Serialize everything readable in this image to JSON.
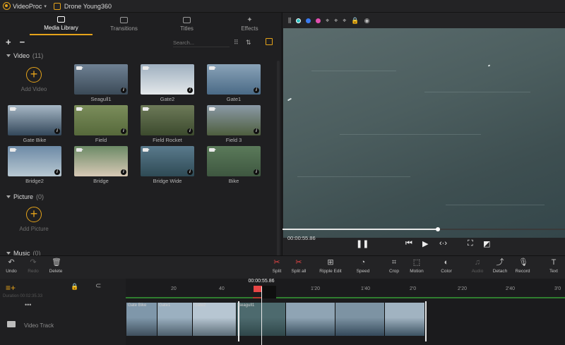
{
  "app": {
    "name": "VideoProc",
    "project": "Drone Young360"
  },
  "tabs": [
    {
      "label": "Media Library",
      "active": true
    },
    {
      "label": "Transitions",
      "active": false
    },
    {
      "label": "Titles",
      "active": false
    },
    {
      "label": "Effects",
      "active": false
    }
  ],
  "library": {
    "search_placeholder": "Search...",
    "video_section": {
      "title": "Video",
      "count": "(11)",
      "add_label": "Add Video"
    },
    "clips": [
      {
        "name": "Seagull1",
        "c1": "#6f8194",
        "c2": "#3b4a57"
      },
      {
        "name": "Gate2",
        "c1": "#9fb0bf",
        "c2": "#e4e8ea"
      },
      {
        "name": "Gate1",
        "c1": "#8aa3b8",
        "c2": "#4a6a86"
      },
      {
        "name": "Gate Bike",
        "c1": "#a7b8c6",
        "c2": "#33475a"
      },
      {
        "name": "Field",
        "c1": "#7b8d5b",
        "c2": "#56693b"
      },
      {
        "name": "Field Rocket",
        "c1": "#6d7a58",
        "c2": "#3c4a2e"
      },
      {
        "name": "Field 3",
        "c1": "#8b9aa7",
        "c2": "#4e5e3e"
      },
      {
        "name": "Bridge2",
        "c1": "#6d8aa6",
        "c2": "#b8c8d2"
      },
      {
        "name": "Bridge",
        "c1": "#6c8a66",
        "c2": "#d8c9b6"
      },
      {
        "name": "Bridge Wide",
        "c1": "#5a7a8c",
        "c2": "#2f4a55"
      },
      {
        "name": "Bike",
        "c1": "#5b7a5a",
        "c2": "#3e5740"
      }
    ],
    "picture_section": {
      "title": "Picture",
      "count": "(0)",
      "add_label": "Add Picture"
    },
    "music_section": {
      "title": "Music",
      "count": "(0)"
    }
  },
  "preview": {
    "time": "00:00:55.86",
    "progress": 0.55
  },
  "tools": [
    {
      "label": "Undo",
      "icon": "↶",
      "dim": false,
      "red": false
    },
    {
      "label": "Redo",
      "icon": "↷",
      "dim": true,
      "red": false
    },
    {
      "label": "Delete",
      "icon": "🗑",
      "dim": false,
      "red": false
    },
    {
      "label": "Split",
      "icon": "✂",
      "dim": false,
      "red": true
    },
    {
      "label": "Split all",
      "icon": "✂",
      "dim": false,
      "red": true
    },
    {
      "label": "Ripple Edit",
      "icon": "⊞",
      "dim": false,
      "red": false
    },
    {
      "label": "Speed",
      "icon": "◔",
      "dim": false,
      "red": false
    },
    {
      "label": "Crop",
      "icon": "⌗",
      "dim": false,
      "red": false
    },
    {
      "label": "Motion",
      "icon": "⬚",
      "dim": false,
      "red": false
    },
    {
      "label": "Color",
      "icon": "◐",
      "dim": false,
      "red": false
    },
    {
      "label": "Audio",
      "icon": "♫",
      "dim": true,
      "red": false
    },
    {
      "label": "Detach",
      "icon": "⤴",
      "dim": false,
      "red": false
    },
    {
      "label": "Record",
      "icon": "🎙",
      "dim": false,
      "red": false
    },
    {
      "label": "Text",
      "icon": "T",
      "dim": false,
      "red": false
    }
  ],
  "timeline": {
    "playhead_time": "00:00:55.86",
    "ticks": [
      "20",
      "40",
      "1'20",
      "1'40",
      "2'0",
      "2'20",
      "2'40",
      "3'0"
    ],
    "duration_label": "Duration   00:02:35.33",
    "track_label": "Video Track",
    "segments": [
      {
        "name": "Gate Bike",
        "color": "#7f97aa",
        "dark": "#3f4f5c"
      },
      {
        "name": "Gate1",
        "color": "#9bb0c0",
        "dark": "#4d5f6c"
      },
      {
        "name": "Gate2",
        "color": "#b7c6d2",
        "dark": "#5c6d78"
      },
      {
        "name": "Seagull1",
        "color": "#4d6a6e",
        "dark": "#2f474a"
      },
      {
        "name": "",
        "color": "#8fa4b4",
        "dark": "#3a4f5e"
      },
      {
        "name": "",
        "color": "#7d93a3",
        "dark": "#34495a"
      },
      {
        "name": "",
        "color": "#a1b3c1",
        "dark": "#3c5262"
      }
    ]
  }
}
